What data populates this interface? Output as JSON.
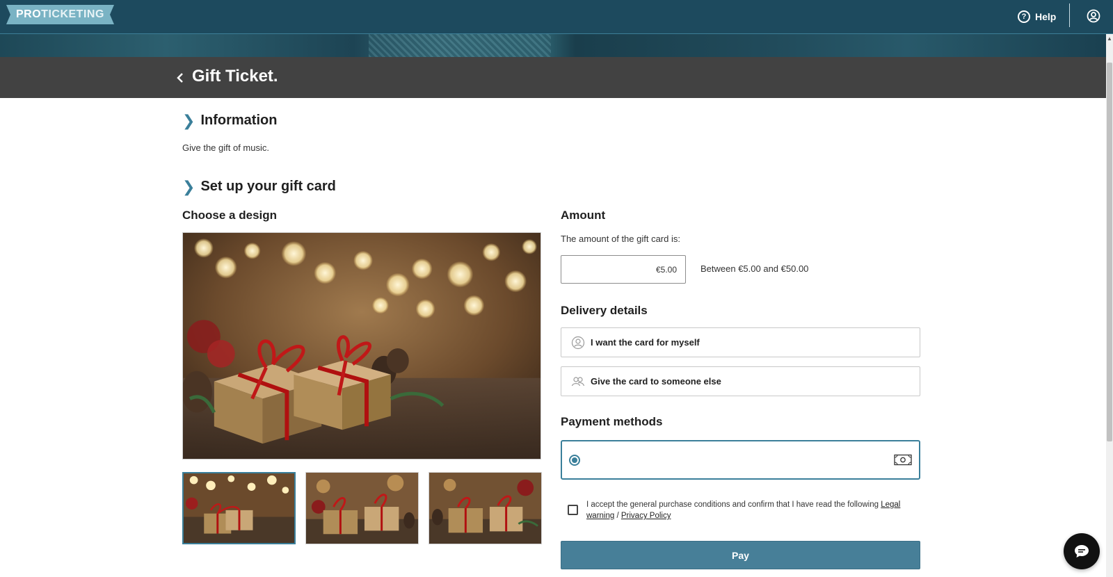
{
  "header": {
    "logo_pro": "PRO",
    "logo_ticketing": "TICKETING",
    "help_label": "Help",
    "help_icon": "question-circle-icon",
    "user_icon": "user-circle-icon"
  },
  "titlebar": {
    "back_icon": "chevron-left-icon",
    "title": "Gift Ticket."
  },
  "information": {
    "heading": "Information",
    "description": "Give the gift of music."
  },
  "setup": {
    "heading": "Set up your gift card",
    "design_heading": "Choose a design",
    "designs": [
      {
        "selected": true
      },
      {
        "selected": false
      },
      {
        "selected": false
      }
    ]
  },
  "amount": {
    "heading": "Amount",
    "label": "The amount of the gift card is:",
    "value": "€5.00",
    "range": "Between €5.00 and €50.00"
  },
  "delivery": {
    "heading": "Delivery details",
    "options": [
      {
        "label": "I want the card for myself",
        "icon": "user-circle-icon"
      },
      {
        "label": "Give the card to someone else",
        "icon": "users-icon"
      }
    ]
  },
  "payment": {
    "heading": "Payment methods",
    "selected": true,
    "icon": "cash-icon"
  },
  "terms": {
    "text": "I accept the general purchase conditions and confirm that I have read the following ",
    "legal_link": "Legal warning",
    "separator": " / ",
    "privacy_link": "Privacy Policy",
    "checked": false
  },
  "pay_button": "Pay",
  "chat_icon": "chat-bubble-icon",
  "colors": {
    "navbar": "#1d4a5e",
    "titlebar": "#424242",
    "accent": "#3a7f9a",
    "pay_button": "#477f98"
  }
}
